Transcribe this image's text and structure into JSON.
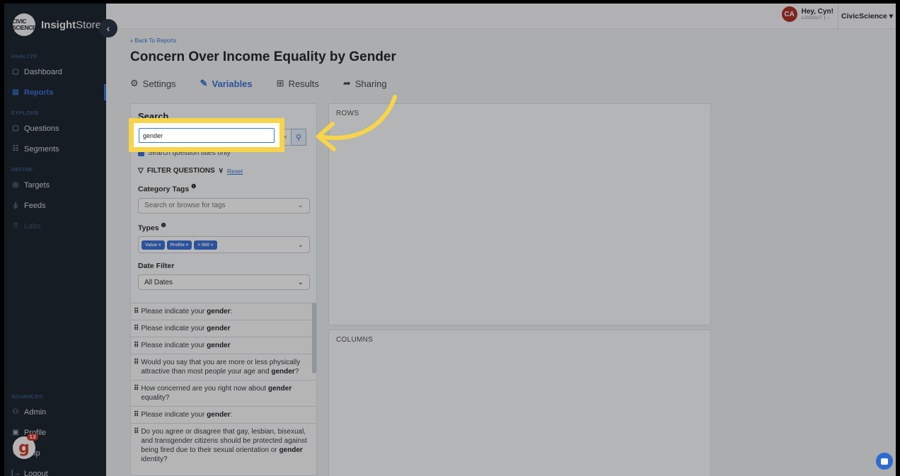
{
  "brand": {
    "logo_text": "CIVIC SCIENCE",
    "name_bold": "Insight",
    "name_rest": "Store"
  },
  "sidebar": {
    "sections": [
      {
        "label": "ANALYZE",
        "items": [
          {
            "icon": "dashboard-icon",
            "glyph": "▢",
            "label": "Dashboard"
          },
          {
            "icon": "reports-icon",
            "glyph": "▤",
            "label": "Reports",
            "active": true
          }
        ]
      },
      {
        "label": "EXPLORE",
        "items": [
          {
            "icon": "questions-icon",
            "glyph": "▢",
            "label": "Questions"
          },
          {
            "icon": "segments-icon",
            "glyph": "☷",
            "label": "Segments"
          }
        ]
      },
      {
        "label": "DEFINE",
        "items": [
          {
            "icon": "targets-icon",
            "glyph": "◎",
            "label": "Targets"
          },
          {
            "icon": "feeds-icon",
            "glyph": "ᵢ|ᵢ",
            "label": "Feeds"
          },
          {
            "icon": "labs-icon",
            "glyph": "⚗",
            "label": "Labs",
            "disabled": true
          }
        ]
      },
      {
        "label": "ADVANCED",
        "items": [
          {
            "icon": "admin-icon",
            "glyph": "⚇",
            "label": "Admin"
          },
          {
            "icon": "profile-icon",
            "glyph": "▣",
            "label": "Profile"
          },
          {
            "icon": "help-icon",
            "glyph": "⊗",
            "label": "Help"
          },
          {
            "icon": "logout-icon",
            "glyph": "[→",
            "label": "Logout"
          }
        ]
      }
    ],
    "badge": {
      "letter": "g",
      "count": "12"
    }
  },
  "topbar": {
    "avatar_initials": "CA",
    "greeting": "Hey, Cyn!",
    "logout_label": "LOGOUT",
    "account_name": "CivicScience"
  },
  "page": {
    "back_link": "« Back To Reports",
    "title": "Concern Over Income Equality by Gender",
    "tabs": [
      {
        "label": "Settings",
        "glyph": "⚙"
      },
      {
        "label": "Variables",
        "glyph": "✎",
        "active": true
      },
      {
        "label": "Results",
        "glyph": "⊞"
      },
      {
        "label": "Sharing",
        "glyph": "➦"
      }
    ]
  },
  "search": {
    "title": "Search",
    "value": "gender",
    "checkbox_label": "Search question titles only",
    "filter_title": "FILTER QUESTIONS",
    "reset_label": "Reset",
    "category_label": "Category Tags",
    "category_placeholder": "Search or browse for tags",
    "types_label": "Types",
    "types_tags": [
      "Value",
      "Profile",
      "> 500"
    ],
    "date_label": "Date Filter",
    "date_value": "All Dates"
  },
  "results": [
    {
      "pre": "Please indicate your ",
      "bold": "gender",
      "post": ":"
    },
    {
      "pre": "Please indicate your ",
      "bold": "gender",
      "post": ""
    },
    {
      "pre": "Please indicate your ",
      "bold": "gender",
      "post": ""
    },
    {
      "pre": "Would you say that you are more or less physically attractive than most people your age and ",
      "bold": "gender",
      "post": "?"
    },
    {
      "pre": "How concerned are you right now about ",
      "bold": "gender",
      "post": " equality?"
    },
    {
      "pre": "Please indicate your ",
      "bold": "gender",
      "post": ":"
    },
    {
      "pre": "Do you agree or disagree that gay, lesbian, bisexual, and transgender citizens should be protected against being fired due to their sexual orientation or ",
      "bold": "gender",
      "post": " identity?"
    }
  ],
  "panels": {
    "rows_label": "ROWS",
    "columns_label": "COLUMNS"
  }
}
